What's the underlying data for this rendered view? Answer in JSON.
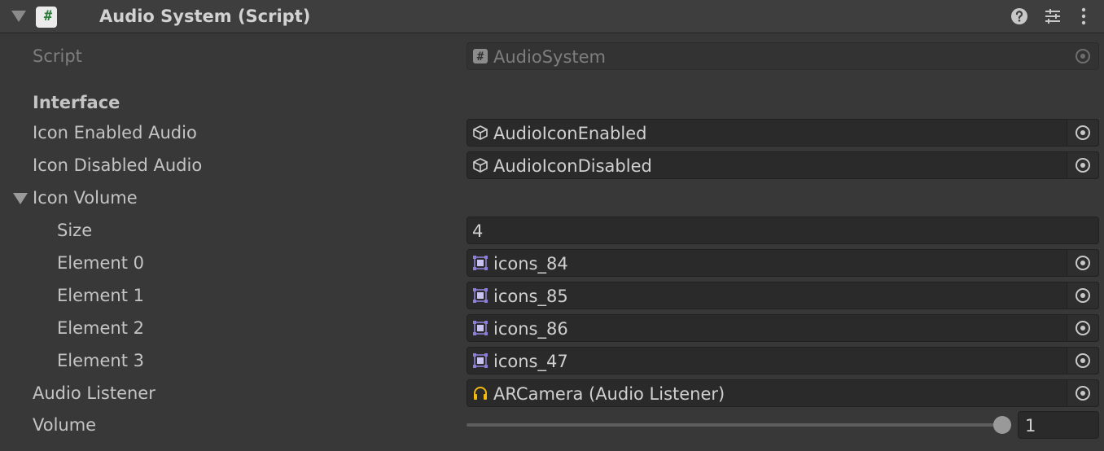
{
  "component": {
    "title": "Audio System (Script)",
    "icons": [
      "help-icon",
      "presets-icon",
      "more-vert-icon"
    ]
  },
  "script_row": {
    "label": "Script",
    "value": "AudioSystem"
  },
  "interface_header": "Interface",
  "icon_enabled_audio": {
    "label": "Icon Enabled Audio",
    "value": "AudioIconEnabled"
  },
  "icon_disabled_audio": {
    "label": "Icon Disabled Audio",
    "value": "AudioIconDisabled"
  },
  "icon_volume": {
    "label": "Icon Volume",
    "size_label": "Size",
    "size_value": "4",
    "elements": [
      {
        "label": "Element 0",
        "value": "icons_84"
      },
      {
        "label": "Element 1",
        "value": "icons_85"
      },
      {
        "label": "Element 2",
        "value": "icons_86"
      },
      {
        "label": "Element 3",
        "value": "icons_47"
      }
    ]
  },
  "audio_listener": {
    "label": "Audio Listener",
    "value": "ARCamera (Audio Listener)"
  },
  "volume": {
    "label": "Volume",
    "value": "1",
    "fraction": 1.0
  },
  "colors": {
    "background": "#383838",
    "field": "#2a2a2a",
    "sprite_icon": "#8c7fd6",
    "listener_icon": "#f2b90f"
  }
}
